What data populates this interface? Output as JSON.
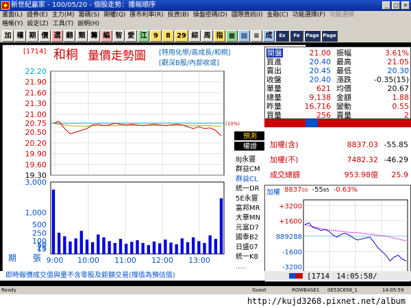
{
  "window": {
    "title": "新世紀贏家 - 100/05/20 - 個股走勢：播報順序"
  },
  "menu1": [
    "畫面(L)",
    "證券(E)",
    "主力(M)",
    "籌碼(S)",
    "期權(Q)",
    "匯市利率(R)",
    "投資(B)",
    "操盤密碼(D)",
    "國際資訊(I)",
    "金融(C)",
    "功能選擇(F)",
    "功能選擇"
  ],
  "menu2": [
    "格帳(Y)",
    "設定(Z)",
    "工具(T)",
    "說明(H)"
  ],
  "toolbar": [
    "加",
    "權",
    "期",
    "價",
    "選",
    "翻",
    "類",
    "籌",
    "編",
    "智",
    "愛",
    "江",
    "9",
    "8",
    "29",
    "綜",
    "周",
    "指",
    "",
    "",
    "",
    "成",
    "Ex",
    "Fe",
    "Page",
    "Page"
  ],
  "stock": {
    "code": "[1714]",
    "name": "和桐",
    "chart_title": "量價走勢圖",
    "categories1": "[特用化學/高成長/和桐]",
    "categories2": "[觀深B股/內部收或]"
  },
  "quote": {
    "open_l": "開盤",
    "open_v": "21.00",
    "amp_l": "振幅",
    "amp_v": "3.61%",
    "buy_l": "買進",
    "buy_v": "20.40",
    "high_l": "最高",
    "high_v": "21.05",
    "sell_l": "賣出",
    "sell_v": "20.45",
    "low_l": "最低",
    "low_v": "20.30",
    "close_l": "收盤",
    "close_v": "20.40",
    "chg_l": "漲跌",
    "chg_v": "-0.35(15)",
    "unit_l": "單量",
    "unit_v": "621",
    "avg_l": "均價",
    "avg_v": "20.67",
    "tvol_l": "總量",
    "tvol_v": "9,138",
    "amt_l": "金額",
    "amt_v": "1.88",
    "yvol_l": "昨量",
    "yvol_v": "16,716",
    "vary_l": "變動",
    "vary_v": "0.55",
    "bvol_l": "買量",
    "bvol_v": "256",
    "svol_l": "賣量",
    "svol_v": "2"
  },
  "index": {
    "incl_l": "加權(含)",
    "incl_v": "8837.03",
    "incl_c": "-55.85",
    "excl_l": "加權(不)",
    "excl_v": "7482.32",
    "excl_c": "-46.29",
    "turn_l": "成交總額",
    "turn_v": "953.98億",
    "turn_c": "25.9"
  },
  "mini": {
    "label": "加權",
    "value": "8837",
    "value_frac": "03",
    "change": "-55",
    "change_frac": "85",
    "pct": "-0.63%",
    "yticks": [
      "+3200",
      "+1600",
      "889288",
      "-1600",
      "-3200"
    ]
  },
  "broker": {
    "header1": "預測",
    "header2": "權證",
    "items": [
      "8J永豐",
      "群益CM",
      "群益CL",
      "統一DR",
      "5E永豐",
      "富邦MR",
      "大華MN",
      "元富D7",
      "國泰B2",
      "日盛07",
      "統一K8",
      "....."
    ]
  },
  "ticker": {
    "text": "即時報價成交值與量不含零股及鉅額交易(撐值為預估值)",
    "code": "[1714",
    "time": "14:05:58/"
  },
  "status": {
    "ready": "Ready",
    "guest": "Guest",
    "server": "ROWBASE1",
    "id": "0E53C658_1",
    "time": "14:05:59"
  },
  "url": "http://kujd3268.pixnet.net/album",
  "colors": {
    "price_line": "#d00000",
    "avg_line": "#c8a000",
    "volume": "#0000e0",
    "ref_line": "#00a0c8"
  },
  "chart_data": {
    "type": "line",
    "x_ticks": [
      "9:00",
      "10:00",
      "11:00",
      "12:00",
      "13:00"
    ],
    "y_price_ticks": [
      "22.20",
      "21.90",
      "21.60",
      "21.30",
      "21.00",
      "20.75",
      "20.50",
      "20.20",
      "19.90",
      "19.60",
      "19.30"
    ],
    "y_volume_ticks": [
      "3,000",
      "1,000",
      "500",
      "250",
      "100",
      "50",
      "25",
      "15"
    ],
    "ylim_price": [
      19.3,
      22.2
    ],
    "ref_price_label": "(10%)",
    "vol_label_left": "期",
    "vol_label_right": "張",
    "price_series": [
      20.75,
      20.8,
      20.6,
      20.45,
      20.5,
      20.55,
      20.6,
      20.7,
      20.72,
      20.68,
      20.7,
      20.75,
      20.72,
      20.7,
      20.72,
      20.7,
      20.68,
      20.7,
      20.72,
      20.7,
      20.68,
      20.7,
      20.72,
      20.7,
      20.65,
      20.6,
      20.65,
      20.6,
      20.62,
      20.55,
      20.4
    ],
    "avg_series": [
      20.75,
      20.72,
      20.7,
      20.68,
      20.67,
      20.67,
      20.67,
      20.68,
      20.68,
      20.68,
      20.68,
      20.68,
      20.69,
      20.69,
      20.69,
      20.69,
      20.69,
      20.69,
      20.69,
      20.69,
      20.69,
      20.69,
      20.69,
      20.69,
      20.69,
      20.68,
      20.68,
      20.68,
      20.68,
      20.67,
      20.67
    ],
    "volume_series": [
      2400,
      260,
      180,
      90,
      140,
      310,
      120,
      80,
      220,
      160,
      95,
      70,
      130,
      60,
      85,
      110,
      70,
      45,
      90,
      65,
      120,
      75,
      55,
      140,
      80,
      160,
      95,
      70,
      200,
      130,
      1800
    ],
    "mini_index_series": [
      1200,
      1400,
      900,
      800,
      600,
      700,
      500,
      100,
      -100,
      200,
      300,
      100,
      -200,
      -400,
      -300,
      -200,
      -100,
      -600,
      -1200,
      -1600,
      -2000,
      -2600,
      -2200,
      -2000,
      -2400,
      -2600
    ],
    "mini_index2_series": [
      1200,
      1100,
      1000,
      900,
      800,
      700,
      650,
      600,
      550,
      500,
      450,
      400,
      380,
      360,
      300,
      250,
      200,
      150,
      100,
      50,
      0,
      -100,
      -200,
      -300,
      -400,
      -500
    ]
  }
}
